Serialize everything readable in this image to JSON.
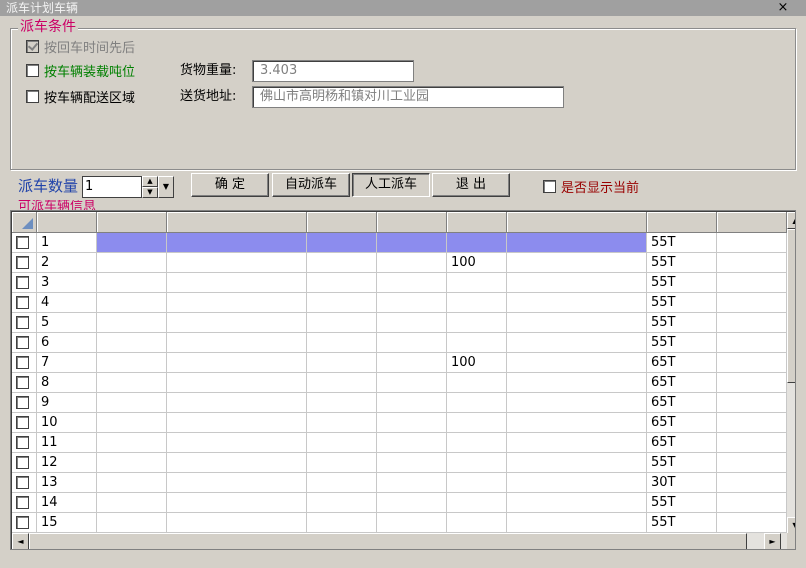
{
  "window": {
    "title": "派车计划车辆",
    "close_glyph": "×"
  },
  "conditions": {
    "legend": "派车条件",
    "by_return_time": {
      "label": "按回车时间先后",
      "checked": true,
      "enabled": false
    },
    "by_capacity": {
      "label": "按车辆装载吨位",
      "checked": false
    },
    "by_area": {
      "label": "按车辆配送区域",
      "checked": false
    },
    "weight_label": "货物重量:",
    "weight_value": "3.403",
    "address_label": "送货地址:",
    "address_value": "佛山市高明杨和镇对川工业园"
  },
  "dispatch": {
    "count_label": "派车数量",
    "count_value": "1",
    "confirm_label": "确  定",
    "auto_label": "自动派车",
    "manual_label": "人工派车",
    "exit_label": "退  出",
    "show_current_label": "是否显示当前",
    "show_current_checked": false
  },
  "grid": {
    "legend": "可派车辆信息",
    "selected_row": 0,
    "rows": [
      {
        "no": "1",
        "c5": "",
        "c7": "55T"
      },
      {
        "no": "2",
        "c5": "100",
        "c7": "55T"
      },
      {
        "no": "3",
        "c5": "",
        "c7": "55T"
      },
      {
        "no": "4",
        "c5": "",
        "c7": "55T"
      },
      {
        "no": "5",
        "c5": "",
        "c7": "55T"
      },
      {
        "no": "6",
        "c5": "",
        "c7": "55T"
      },
      {
        "no": "7",
        "c5": "100",
        "c7": "65T"
      },
      {
        "no": "8",
        "c5": "",
        "c7": "65T"
      },
      {
        "no": "9",
        "c5": "",
        "c7": "65T"
      },
      {
        "no": "10",
        "c5": "",
        "c7": "65T"
      },
      {
        "no": "11",
        "c5": "",
        "c7": "65T"
      },
      {
        "no": "12",
        "c5": "",
        "c7": "55T"
      },
      {
        "no": "13",
        "c5": "",
        "c7": "30T"
      },
      {
        "no": "14",
        "c5": "",
        "c7": "55T"
      },
      {
        "no": "15",
        "c5": "",
        "c7": "55T"
      }
    ]
  },
  "icons": {
    "corner": "select-all-icon",
    "scroll_up": "▲",
    "scroll_down": "▼",
    "scroll_left": "◄",
    "scroll_right": "►",
    "spin_up": "▲",
    "spin_down": "▼",
    "dropdown": "▼"
  }
}
